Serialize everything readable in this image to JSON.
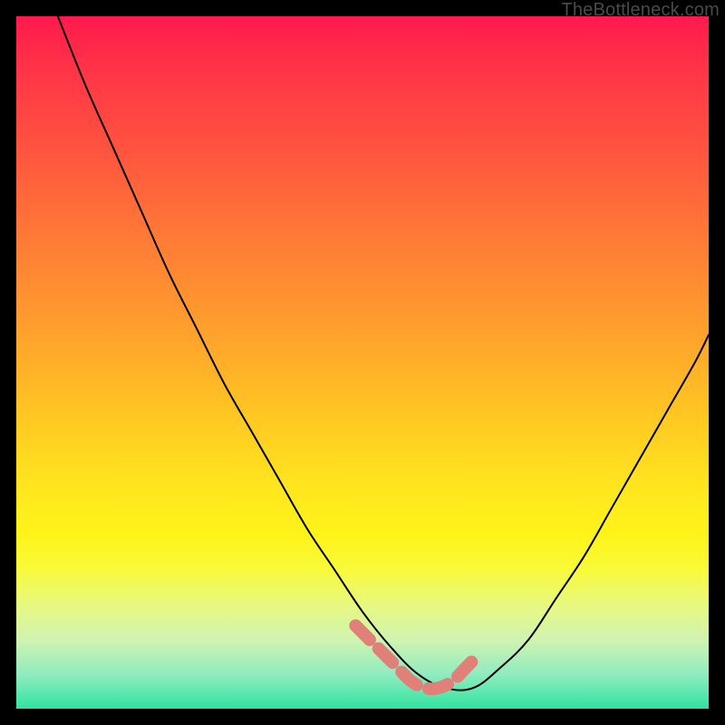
{
  "watermark": "TheBottleneck.com",
  "chart_data": {
    "type": "line",
    "title": "",
    "xlabel": "",
    "ylabel": "",
    "xlim": [
      0,
      100
    ],
    "ylim": [
      0,
      100
    ],
    "grid": false,
    "series": [
      {
        "name": "bottleneck-curve",
        "color": "#000000",
        "x": [
          6,
          10,
          14,
          18,
          22,
          26,
          30,
          34,
          38,
          42,
          46,
          50,
          54,
          58,
          62,
          66,
          70,
          74,
          78,
          82,
          86,
          90,
          94,
          98,
          100
        ],
        "values": [
          100,
          90,
          81,
          72,
          63,
          55,
          47,
          40,
          33,
          26,
          20,
          14,
          9,
          5,
          3,
          3,
          6,
          10,
          16,
          22,
          29,
          36,
          43,
          50,
          54
        ]
      },
      {
        "name": "minimum-highlight",
        "color": "#e08078",
        "x": [
          49,
          51,
          53,
          55,
          57,
          59,
          61,
          63,
          65,
          67
        ],
        "values": [
          12,
          10,
          8,
          6,
          4,
          3,
          3,
          4,
          6,
          8
        ]
      }
    ],
    "annotations": []
  },
  "colors": {
    "gradient_top": "#ff1a4d",
    "gradient_bottom": "#2fe3a0",
    "curve": "#000000",
    "highlight": "#e08078",
    "frame": "#000000",
    "watermark": "#4a4a4a"
  }
}
